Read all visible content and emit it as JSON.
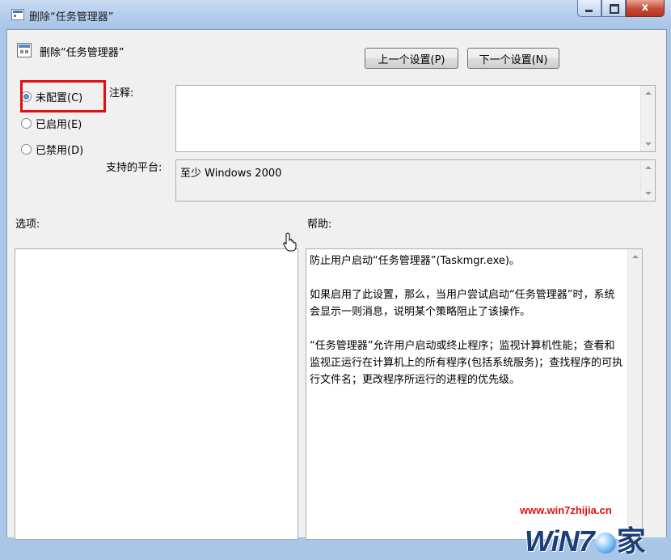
{
  "window": {
    "title": "删除“任务管理器”",
    "close_glyph": "x"
  },
  "policy": {
    "title": "删除“任务管理器”"
  },
  "nav": {
    "prev_label": "上一个设置(P)",
    "next_label": "下一个设置(N)"
  },
  "options": {
    "not_configured": "未配置(C)",
    "enabled": "已启用(E)",
    "disabled": "已禁用(D)",
    "selected": "not_configured"
  },
  "labels": {
    "comment": "注释:",
    "supported_on": "支持的平台:",
    "options": "选项:",
    "help": "帮助:"
  },
  "comment_value": "",
  "supported_on_value": "至少 Windows 2000",
  "help_text": {
    "p1": "防止用户启动“任务管理器”(Taskmgr.exe)。",
    "p2": "如果启用了此设置，那么，当用户尝试启动“任务管理器”时，系统会显示一则消息，说明某个策略阻止了该操作。",
    "p3": "“任务管理器”允许用户启动或终止程序；监视计算机性能；查看和监视正运行在计算机上的所有程序(包括系统服务)；查找程序的可执行文件名；更改程序所运行的进程的优先级。"
  },
  "watermark": {
    "url": "www.win7zhijia.cn",
    "logo_text": "WiN7",
    "logo_suffix": "家"
  },
  "colors": {
    "highlight_border": "#e01010",
    "titlebar": "#b6cfed",
    "client_bg": "#f0f0f0"
  }
}
